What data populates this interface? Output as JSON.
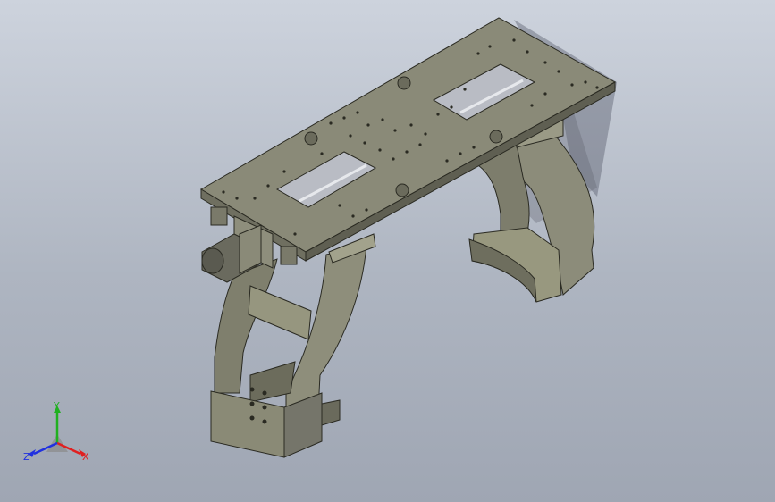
{
  "viewport": {
    "background_top": "#cdd3dd",
    "background_bottom": "#9fa6b3"
  },
  "model": {
    "face_color": "#8a8a78",
    "edge_color": "#2a2a22"
  },
  "triad": {
    "x_label": "X",
    "y_label": "Y",
    "z_label": "Z",
    "x_color": "#e02020",
    "y_color": "#20b020",
    "z_color": "#2030e0"
  }
}
